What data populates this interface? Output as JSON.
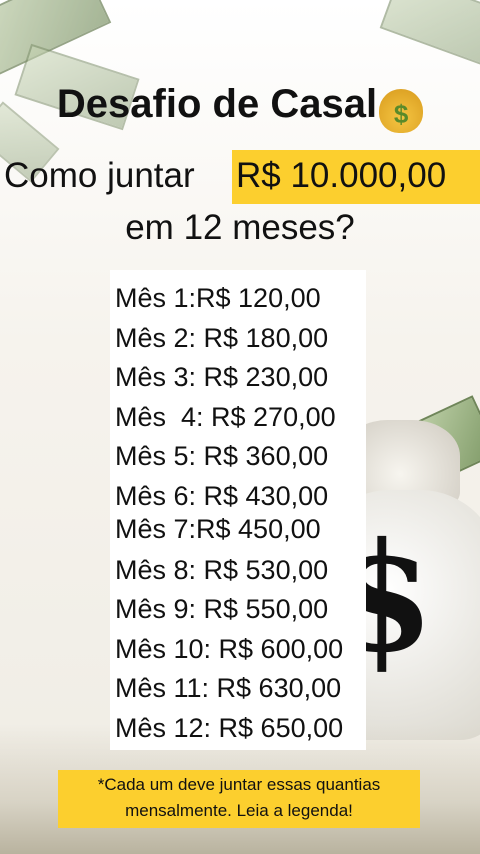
{
  "title": "Desafio de Casal",
  "title_emoji": "$",
  "subtitle_lead": "Como juntar",
  "subtitle_highlight": "R$ 10.000,00",
  "subtitle_line2": "em 12 meses?",
  "months": [
    "Mês 1:R$ 120,00",
    "Mês 2: R$ 180,00",
    "Mês 3: R$ 230,00",
    "Mês  4: R$ 270,00",
    "Mês 5: R$ 360,00",
    "Mês 6: R$ 430,00",
    "Mês 7:R$ 450,00",
    "Mês 8: R$ 530,00",
    "Mês 9: R$ 550,00",
    "Mês 10: R$ 600,00",
    "Mês 11: R$ 630,00",
    "Mês 12: R$ 650,00"
  ],
  "note_line1": "*Cada um deve juntar essas quantias",
  "note_line2": "mensalmente. Leia a legenda!",
  "colors": {
    "highlight": "#fccf2e",
    "text": "#111111"
  },
  "icons": [
    "money-bag-icon"
  ]
}
